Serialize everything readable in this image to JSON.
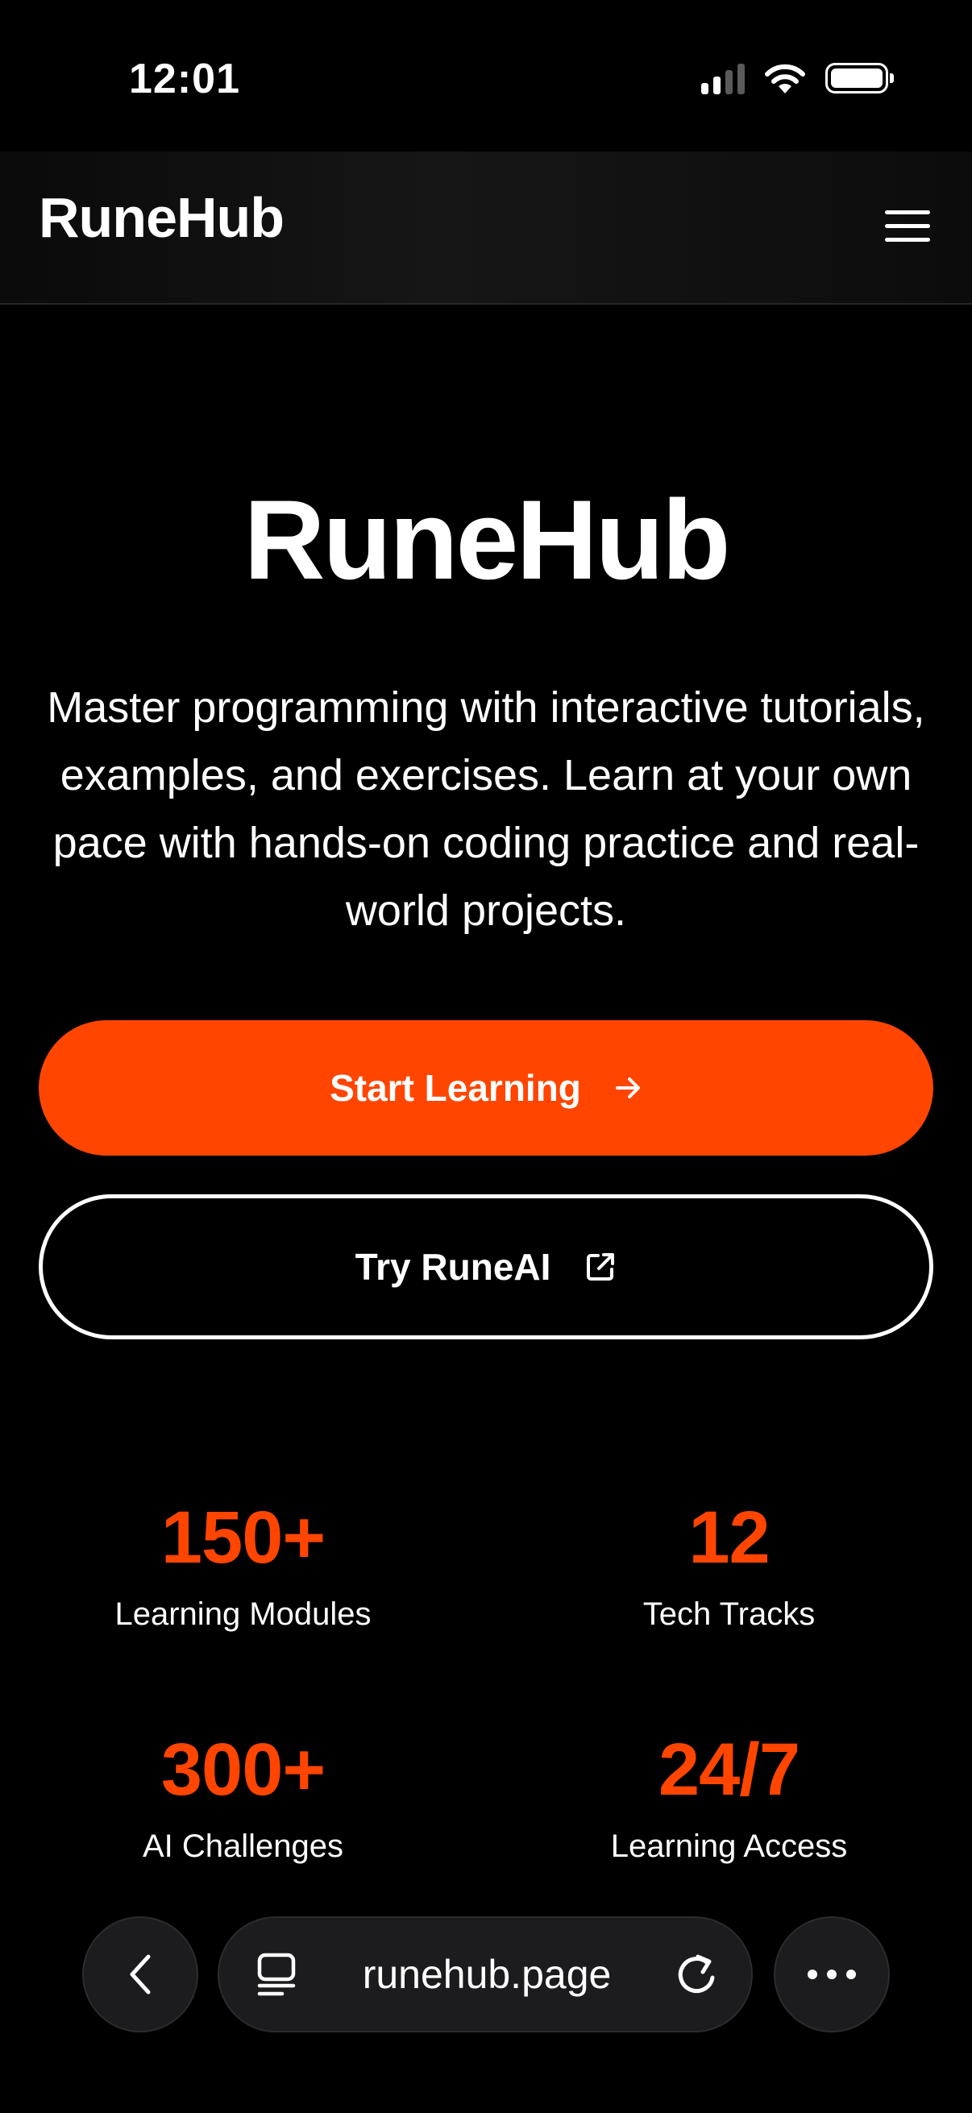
{
  "status_bar": {
    "time": "12:01"
  },
  "header": {
    "logo": "RuneHub",
    "menu_icon": "hamburger-menu-icon"
  },
  "hero": {
    "title": "RuneHub",
    "description": "Master programming with interactive tutorials, examples, and exercises. Learn at your own pace with hands-on coding practice and real-world projects."
  },
  "buttons": {
    "primary_label": "Start Learning",
    "primary_icon": "arrow-right-icon",
    "secondary_label": "Try RuneAI",
    "secondary_icon": "external-link-icon"
  },
  "stats": [
    {
      "value": "150+",
      "label": "Learning Modules"
    },
    {
      "value": "12",
      "label": "Tech Tracks"
    },
    {
      "value": "300+",
      "label": "AI Challenges"
    },
    {
      "value": "24/7",
      "label": "Learning Access"
    }
  ],
  "browser": {
    "url": "runehub.page",
    "back_icon": "chevron-left-icon",
    "page_icon": "page-menu-icon",
    "reload_icon": "reload-icon",
    "more_icon": "more-icon"
  },
  "colors": {
    "accent": "#ff4500",
    "background": "#000000",
    "text": "#ffffff"
  }
}
